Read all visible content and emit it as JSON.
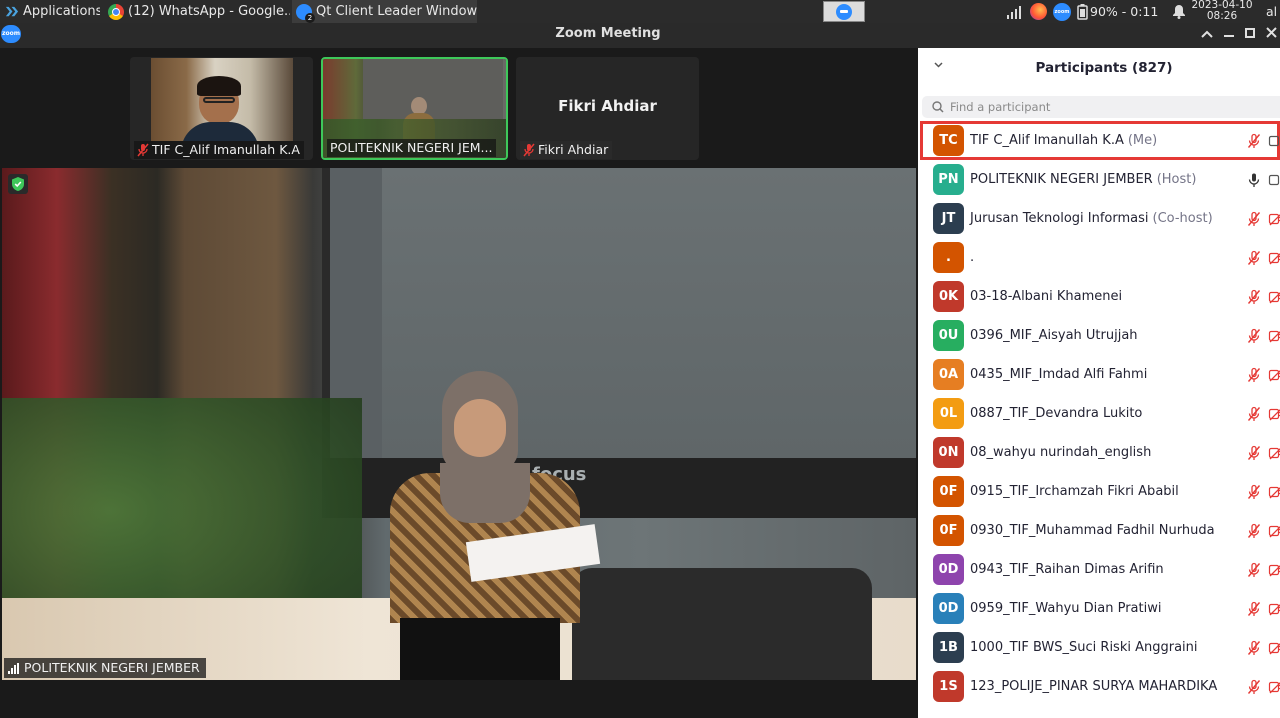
{
  "taskbar": {
    "applications": "Applications",
    "windows": [
      {
        "label": "(12) WhatsApp - Google...",
        "icon": "chrome-icon"
      },
      {
        "label": "Qt Client Leader Window",
        "icon": "zoom-icon",
        "badge": "2"
      }
    ],
    "battery": "90% - 0:11",
    "date": "2023-04-10",
    "time": "08:26",
    "user": "al"
  },
  "window": {
    "title": "Zoom Meeting",
    "logo_text": "zoom"
  },
  "gallery": [
    {
      "name": "TIF C_Alif Imanullah K.A",
      "muted": true,
      "selected": false
    },
    {
      "name": "POLITEKNIK NEGERI JEM...",
      "muted": false,
      "selected": true
    },
    {
      "name": "Fikri Ahdiar",
      "muted": true,
      "selected": false,
      "display_name": "Fikri Ahdiar"
    }
  ],
  "main_video": {
    "label": "POLITEKNIK NEGERI JEMBER",
    "screen_text": "focus"
  },
  "participants": {
    "title": "Participants (827)",
    "search_placeholder": "Find a participant",
    "items": [
      {
        "initials": "TC",
        "name": "TIF C_Alif Imanullah K.A",
        "role": "(Me)",
        "color": "#d35400",
        "muted": true,
        "me": true
      },
      {
        "initials": "PN",
        "name": "POLITEKNIK NEGERI JEMBER",
        "role": "(Host)",
        "color": "#27ae8e",
        "muted": false
      },
      {
        "initials": "JT",
        "name": "Jurusan Teknologi Informasi",
        "role": "(Co-host)",
        "color": "#2c3e50",
        "muted": true
      },
      {
        "initials": ".",
        "name": ".",
        "role": "",
        "color": "#d35400",
        "muted": true
      },
      {
        "initials": "0K",
        "name": "03-18-Albani Khamenei",
        "role": "",
        "color": "#c0392b",
        "muted": true
      },
      {
        "initials": "0U",
        "name": "0396_MIF_Aisyah Utrujjah",
        "role": "",
        "color": "#27ae60",
        "muted": true
      },
      {
        "initials": "0A",
        "name": "0435_MIF_Imdad Alfi Fahmi",
        "role": "",
        "color": "#e67e22",
        "muted": true
      },
      {
        "initials": "0L",
        "name": "0887_TIF_Devandra Lukito",
        "role": "",
        "color": "#f39c12",
        "muted": true
      },
      {
        "initials": "0N",
        "name": "08_wahyu nurindah_english",
        "role": "",
        "color": "#c0392b",
        "muted": true
      },
      {
        "initials": "0F",
        "name": "0915_TIF_Irchamzah Fikri Ababil",
        "role": "",
        "color": "#d35400",
        "muted": true
      },
      {
        "initials": "0F",
        "name": "0930_TIF_Muhammad Fadhil Nurhuda",
        "role": "",
        "color": "#d35400",
        "muted": true
      },
      {
        "initials": "0D",
        "name": "0943_TIF_Raihan Dimas Arifin",
        "role": "",
        "color": "#8e44ad",
        "muted": true
      },
      {
        "initials": "0D",
        "name": "0959_TIF_Wahyu Dian Pratiwi",
        "role": "",
        "color": "#2980b9",
        "muted": true
      },
      {
        "initials": "1B",
        "name": "1000_TIF BWS_Suci Riski Anggraini",
        "role": "",
        "color": "#2c3e50",
        "muted": true
      },
      {
        "initials": "1S",
        "name": "123_POLIJE_PINAR SURYA MAHARDIKA",
        "role": "",
        "color": "#c0392b",
        "muted": true
      }
    ]
  }
}
